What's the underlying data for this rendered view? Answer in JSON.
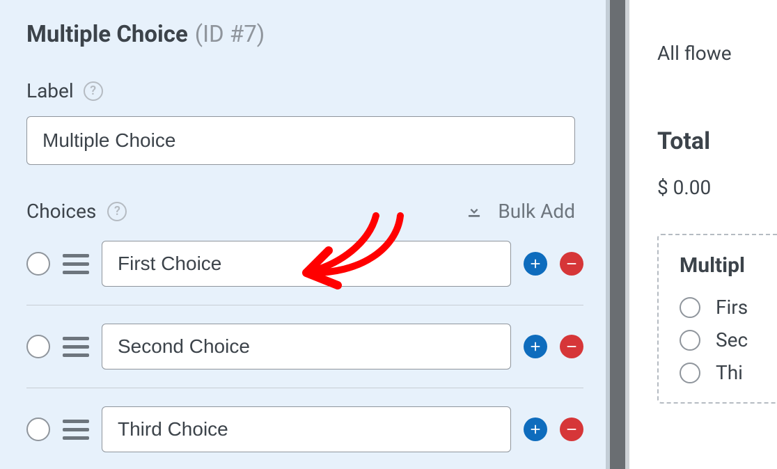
{
  "panel": {
    "title": "Multiple Choice",
    "id_text": "(ID #7)",
    "label_section": "Label",
    "label_value": "Multiple Choice",
    "choices_section": "Choices",
    "bulk_add": "Bulk Add"
  },
  "choices": [
    {
      "value": "First Choice"
    },
    {
      "value": "Second Choice"
    },
    {
      "value": "Third Choice"
    }
  ],
  "preview": {
    "flower_line": "All flowe",
    "total_label": "Total",
    "total_value": "$ 0.00",
    "field_heading": "Multipl",
    "options": [
      "Firs",
      "Sec",
      "Thi"
    ]
  }
}
